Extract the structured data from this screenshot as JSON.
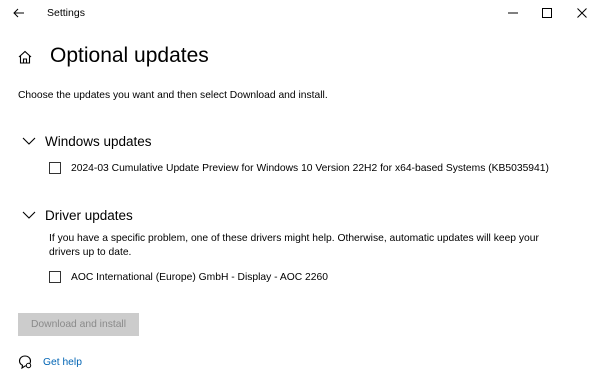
{
  "window": {
    "app_title": "Settings",
    "back_icon": "arrow-left-icon",
    "controls": [
      "minimize-icon",
      "maximize-icon",
      "close-icon"
    ]
  },
  "header": {
    "title": "Optional updates",
    "icon": "home-icon"
  },
  "instructions": "Choose the updates you want and then select Download and install.",
  "sections": {
    "windows_updates": {
      "title": "Windows updates",
      "items": [
        {
          "label": "2024-03 Cumulative Update Preview for Windows 10 Version 22H2 for x64-based Systems (KB5035941)",
          "checked": false
        }
      ]
    },
    "driver_updates": {
      "title": "Driver updates",
      "note": "If you have a specific problem, one of these drivers might help. Otherwise, automatic updates will keep your drivers up to date.",
      "items": [
        {
          "label": "AOC International (Europe) GmbH - Display - AOC 2260",
          "checked": false
        }
      ]
    }
  },
  "actions": {
    "download_label": "Download and install",
    "download_enabled": false
  },
  "help": {
    "label": "Get help",
    "icon": "chat-help-icon"
  },
  "colors": {
    "link": "#0064b4",
    "disabled_button_bg": "#cccccc",
    "disabled_button_text": "#8a8a8a"
  }
}
